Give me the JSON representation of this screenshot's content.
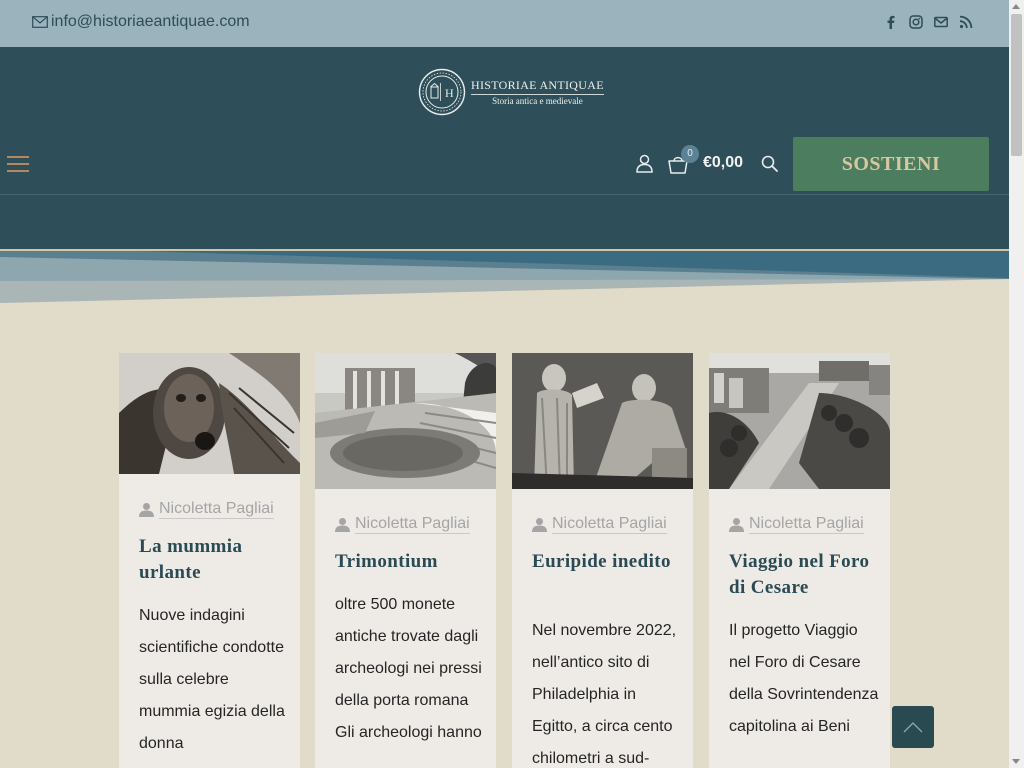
{
  "topbar": {
    "email": "info@historiaeantiquae.com",
    "social_icons": [
      "facebook-icon",
      "instagram-icon",
      "mail-icon",
      "rss-icon"
    ]
  },
  "brand": {
    "title": "HISTORIAE ANTIQUAE",
    "subtitle": "Storia antica e medievale",
    "monogram": "H"
  },
  "header": {
    "cart_count": "0",
    "cart_total": "€0,00",
    "cta_label": "SOSTIENI"
  },
  "colors": {
    "topbar": "#9bb3bd",
    "header": "#2e4e59",
    "cta": "#4b7d5e",
    "cta_text": "#d9c7a0",
    "page_bg": "#e1dbc9",
    "card_bg": "#eeebe6",
    "title_color": "#2a4a54"
  },
  "posts": [
    {
      "author": "Nicoletta Pagliai",
      "title": "La mummia urlante",
      "excerpt": "Nuove indagini scientifiche condotte sulla celebre mummia egizia della donna",
      "image": "mummy-photo"
    },
    {
      "author": "Nicoletta Pagliai",
      "title": "Trimontium",
      "excerpt": "oltre 500 monete antiche trovate dagli archeologi nei pressi della porta romana Gli archeologi hanno",
      "image": "roman-theatre-photo"
    },
    {
      "author": "Nicoletta Pagliai",
      "title": "Euripide inedito",
      "excerpt": "Nel novembre 2022, nell’antico sito di Philadelphia in Egitto, a circa cento chilometri a sud-",
      "image": "relief-sculpture-photo"
    },
    {
      "author": "Nicoletta Pagliai",
      "title": "Viaggio nel Foro di Cesare",
      "excerpt": "Il progetto Viaggio nel Foro di Cesare della Sovrintendenza capitolina ai Beni",
      "image": "roman-forum-photo"
    }
  ]
}
